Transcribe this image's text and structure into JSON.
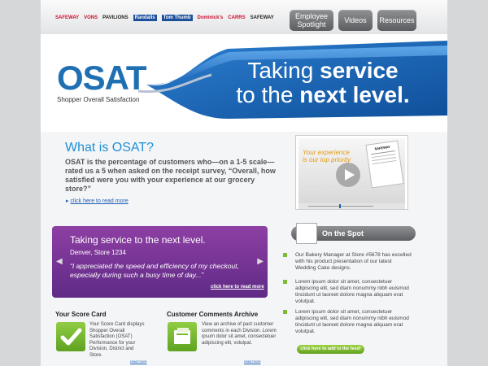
{
  "brands": [
    "SAFEWAY",
    "VONS",
    "PAVILIONS",
    "Randalls",
    "Tom Thumb",
    "Dominick's",
    "CARRS",
    "SAFEWAY"
  ],
  "nav": [
    {
      "label": "Employee Spotlight"
    },
    {
      "label": "Videos"
    },
    {
      "label": "Resources"
    }
  ],
  "hero": {
    "logo": "OSAT",
    "logo_sub": "Shopper Overall Satisfaction",
    "tagline_1a": "Taking ",
    "tagline_1b": "service",
    "tagline_2a": "to the ",
    "tagline_2b": "next level."
  },
  "whatis": {
    "title": "What is OSAT?",
    "desc": "OSAT is the percentage of customers who—on a 1-5 scale—rated us a 5 when asked on the receipt survey, “Overall, how satisfied were you with your experience at our grocery store?”",
    "readmore": "click here to read more"
  },
  "video": {
    "title": "Your experience is our top priority",
    "receipt_brand": "SAFEWAY"
  },
  "testimonial": {
    "title": "Taking service to the next level.",
    "location": "Denver, Store 1234",
    "quote": "“I appreciated the speed and efficiency of my checkout, especially during such a busy time of day...”",
    "readmore": "click here to read more"
  },
  "on_the_spot": {
    "title": "On the Spot",
    "items": [
      {
        "text": "Our Bakery Manager at Store #5678 has excelled with his product presentation of our latest Wedding Cake designs."
      },
      {
        "text": "Lorem ipsum dolor sit amet, consectetuer adipiscing elit, sed diam nonummy nibh euismod tincidunt ut laoreet dolore magna aliquam erat volutpat."
      },
      {
        "text": "Lorem ipsum dolor sit amet, consectetuer adipiscing elit, sed diam nonummy nibh euismod tincidunt ut laoreet dolore magna aliquam erat volutpat."
      }
    ],
    "add_feed": "click here to add to the feed!"
  },
  "scorecard": {
    "title": "Your Score Card",
    "desc": "Your Score Card displays Shopper Overall Satisfaction (OSAT) Performance for your Division, District and Store.",
    "readmore": "read more"
  },
  "comments": {
    "title": "Customer Comments Archive",
    "desc": "View an archive of past customer comments in each Division. Lorem ipsum dolor sit amet, consectetuer adipiscing elit, volutpat.",
    "readmore": "read more"
  },
  "colors": {
    "accent_blue": "#1f6fb3",
    "purple": "#6f2f94",
    "green": "#7dbb33"
  }
}
